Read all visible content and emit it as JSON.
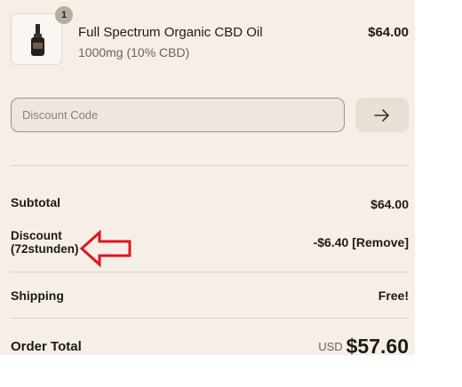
{
  "cart": {
    "item": {
      "quantity": "1",
      "name": "Full Spectrum Organic CBD Oil",
      "variant": "1000mg (10% CBD)",
      "price": "$64.00"
    }
  },
  "discount_field": {
    "placeholder": "Discount Code",
    "apply_icon": "arrow-right-icon"
  },
  "summary": {
    "subtotal_label": "Subtotal",
    "subtotal_value": "$64.00",
    "discount_label_line1": "Discount",
    "discount_label_line2": "(72stunden)",
    "discount_value": "-$6.40",
    "remove_label": "[Remove]",
    "shipping_label": "Shipping",
    "shipping_value": "Free!",
    "total_label": "Order Total",
    "currency": "USD",
    "total_value": "$57.60"
  },
  "annotation": {
    "icon": "red-arrow-left-icon",
    "color": "#e0141e"
  },
  "colors": {
    "panel_background": "#f6efe8",
    "text": "#1e1a17"
  }
}
